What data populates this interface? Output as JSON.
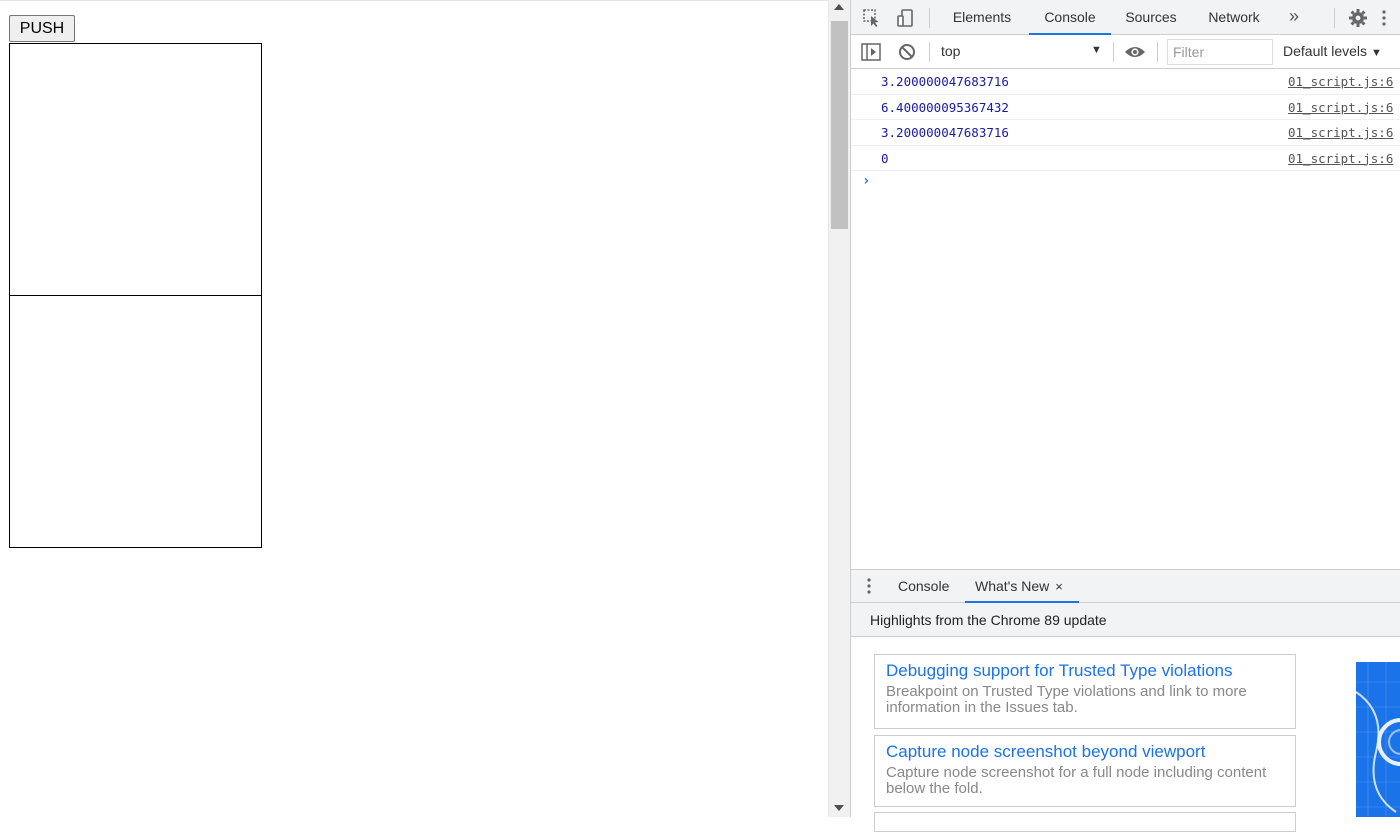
{
  "page": {
    "push_button_label": "PUSH"
  },
  "devtools": {
    "main_tabs": [
      {
        "label": "Elements"
      },
      {
        "label": "Console"
      },
      {
        "label": "Sources"
      },
      {
        "label": "Network"
      }
    ],
    "more_tabs_label": "»",
    "active_tab": "Console",
    "console_toolbar": {
      "context": "top",
      "filter_placeholder": "Filter",
      "levels": "Default levels"
    },
    "console_messages": [
      {
        "value": "3.200000047683716",
        "source": "01_script.js:6"
      },
      {
        "value": "6.400000095367432",
        "source": "01_script.js:6"
      },
      {
        "value": "3.200000047683716",
        "source": "01_script.js:6"
      },
      {
        "value": "0",
        "source": "01_script.js:6"
      }
    ],
    "prompt": "›",
    "drawer": {
      "tabs": [
        {
          "label": "Console"
        },
        {
          "label": "What's New"
        }
      ],
      "active_tab": "What's New",
      "close_glyph": "×",
      "heading": "Highlights from the Chrome 89 update",
      "features": [
        {
          "title": "Debugging support for Trusted Type violations",
          "description": "Breakpoint on Trusted Type violations and link to more information in the Issues tab."
        },
        {
          "title": "Capture node screenshot beyond viewport",
          "description": "Capture node screenshot for a full node including content below the fold."
        }
      ]
    }
  },
  "colors": {
    "accent": "#1a73e8",
    "console_value": "#1a1aa6"
  }
}
